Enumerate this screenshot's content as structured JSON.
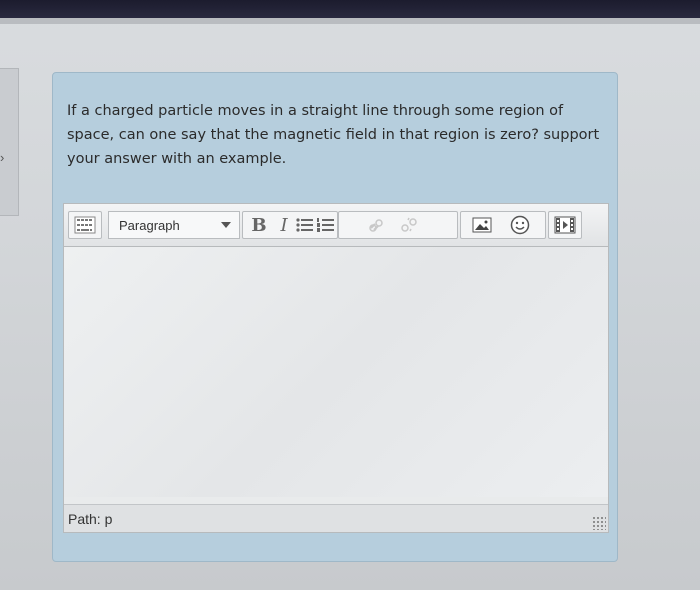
{
  "question": {
    "lines": [
      "If a charged particle moves in a straight line through some region of",
      "space, can one say that the magnetic field in that region is zero? support",
      "your answer with an example."
    ]
  },
  "editor": {
    "format_select": "Paragraph",
    "bold_label": "B",
    "italic_label": "I",
    "answer_text": "",
    "path_label": "Path: p"
  },
  "colors": {
    "card": "#b6cedd",
    "toolbar": "#e1e3e5"
  }
}
